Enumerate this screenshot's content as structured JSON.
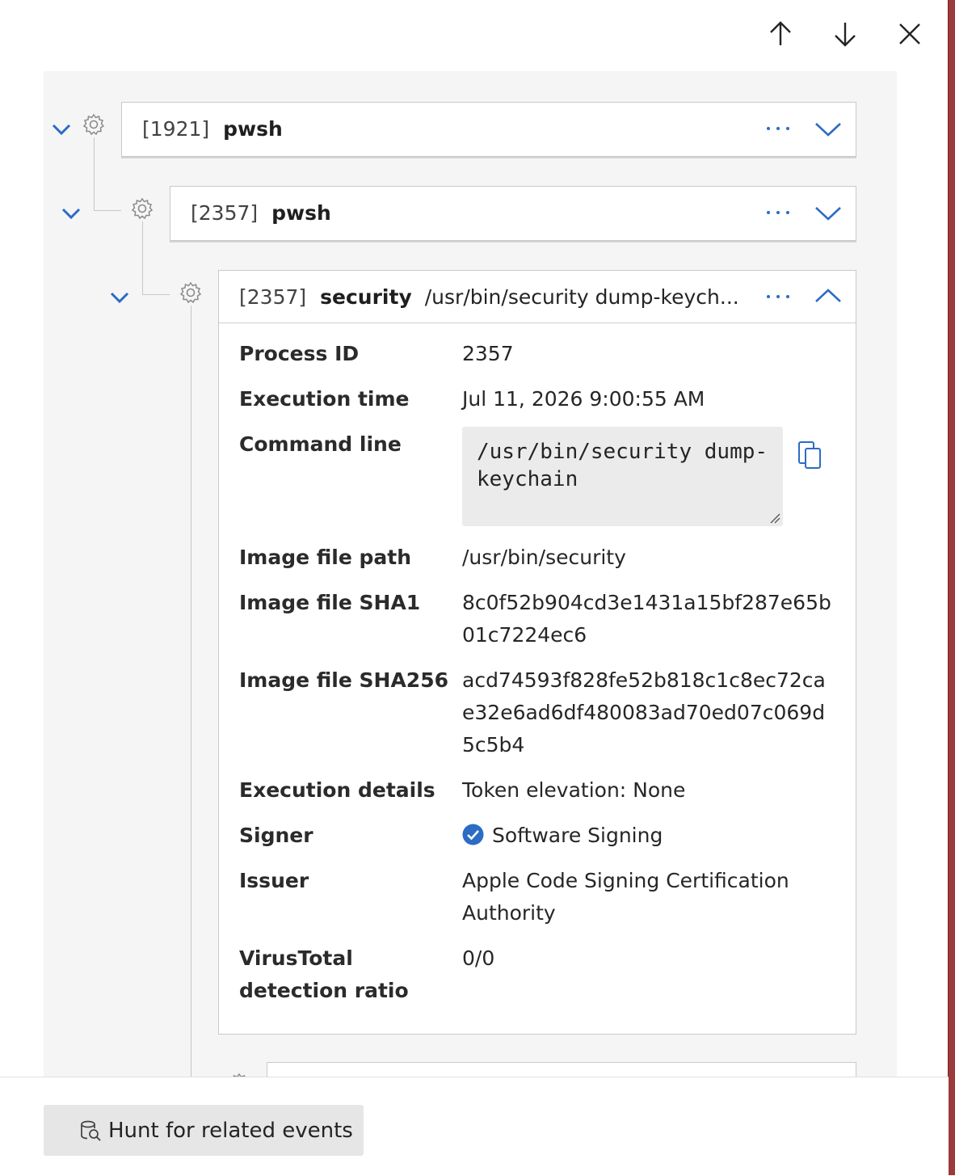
{
  "nav": {
    "up_icon": "arrow-up-icon",
    "down_icon": "arrow-down-icon",
    "close_icon": "close-icon"
  },
  "tree": {
    "nodes": [
      {
        "pid": "[1921]",
        "name": "pwsh",
        "command": ""
      },
      {
        "pid": "[2357]",
        "name": "pwsh",
        "command": ""
      },
      {
        "pid": "[2357]",
        "name": "security",
        "command": "/usr/bin/security dump-keych..."
      }
    ]
  },
  "details": {
    "process_id": {
      "label": "Process ID",
      "value": "2357"
    },
    "execution_time": {
      "label": "Execution time",
      "value": "Jul 11, 2026 9:00:55 AM"
    },
    "command_line": {
      "label": "Command line",
      "value": "/usr/bin/security dump-keychain"
    },
    "image_file_path": {
      "label": "Image file path",
      "value": "/usr/bin/security"
    },
    "image_file_sha1": {
      "label": "Image file SHA1",
      "value": "8c0f52b904cd3e1431a15bf287e65b01c7224ec6"
    },
    "image_file_sha256": {
      "label": "Image file SHA256",
      "value": "acd74593f828fe52b818c1c8ec72cae32e6ad6df480083ad70ed07c069d5c5b4"
    },
    "execution_details": {
      "label": "Execution details",
      "value": "Token elevation: None"
    },
    "signer": {
      "label": "Signer",
      "value": "Software Signing"
    },
    "issuer": {
      "label": "Issuer",
      "value": "Apple Code Signing Certification Authority"
    },
    "virustotal": {
      "label": "VirusTotal detection ratio",
      "value": "0/0"
    }
  },
  "footer": {
    "hunt_label": "Hunt for related events"
  },
  "colors": {
    "accent": "#2b6cc4",
    "panel_bg": "#f5f5f5",
    "border": "#c9c9c9"
  }
}
